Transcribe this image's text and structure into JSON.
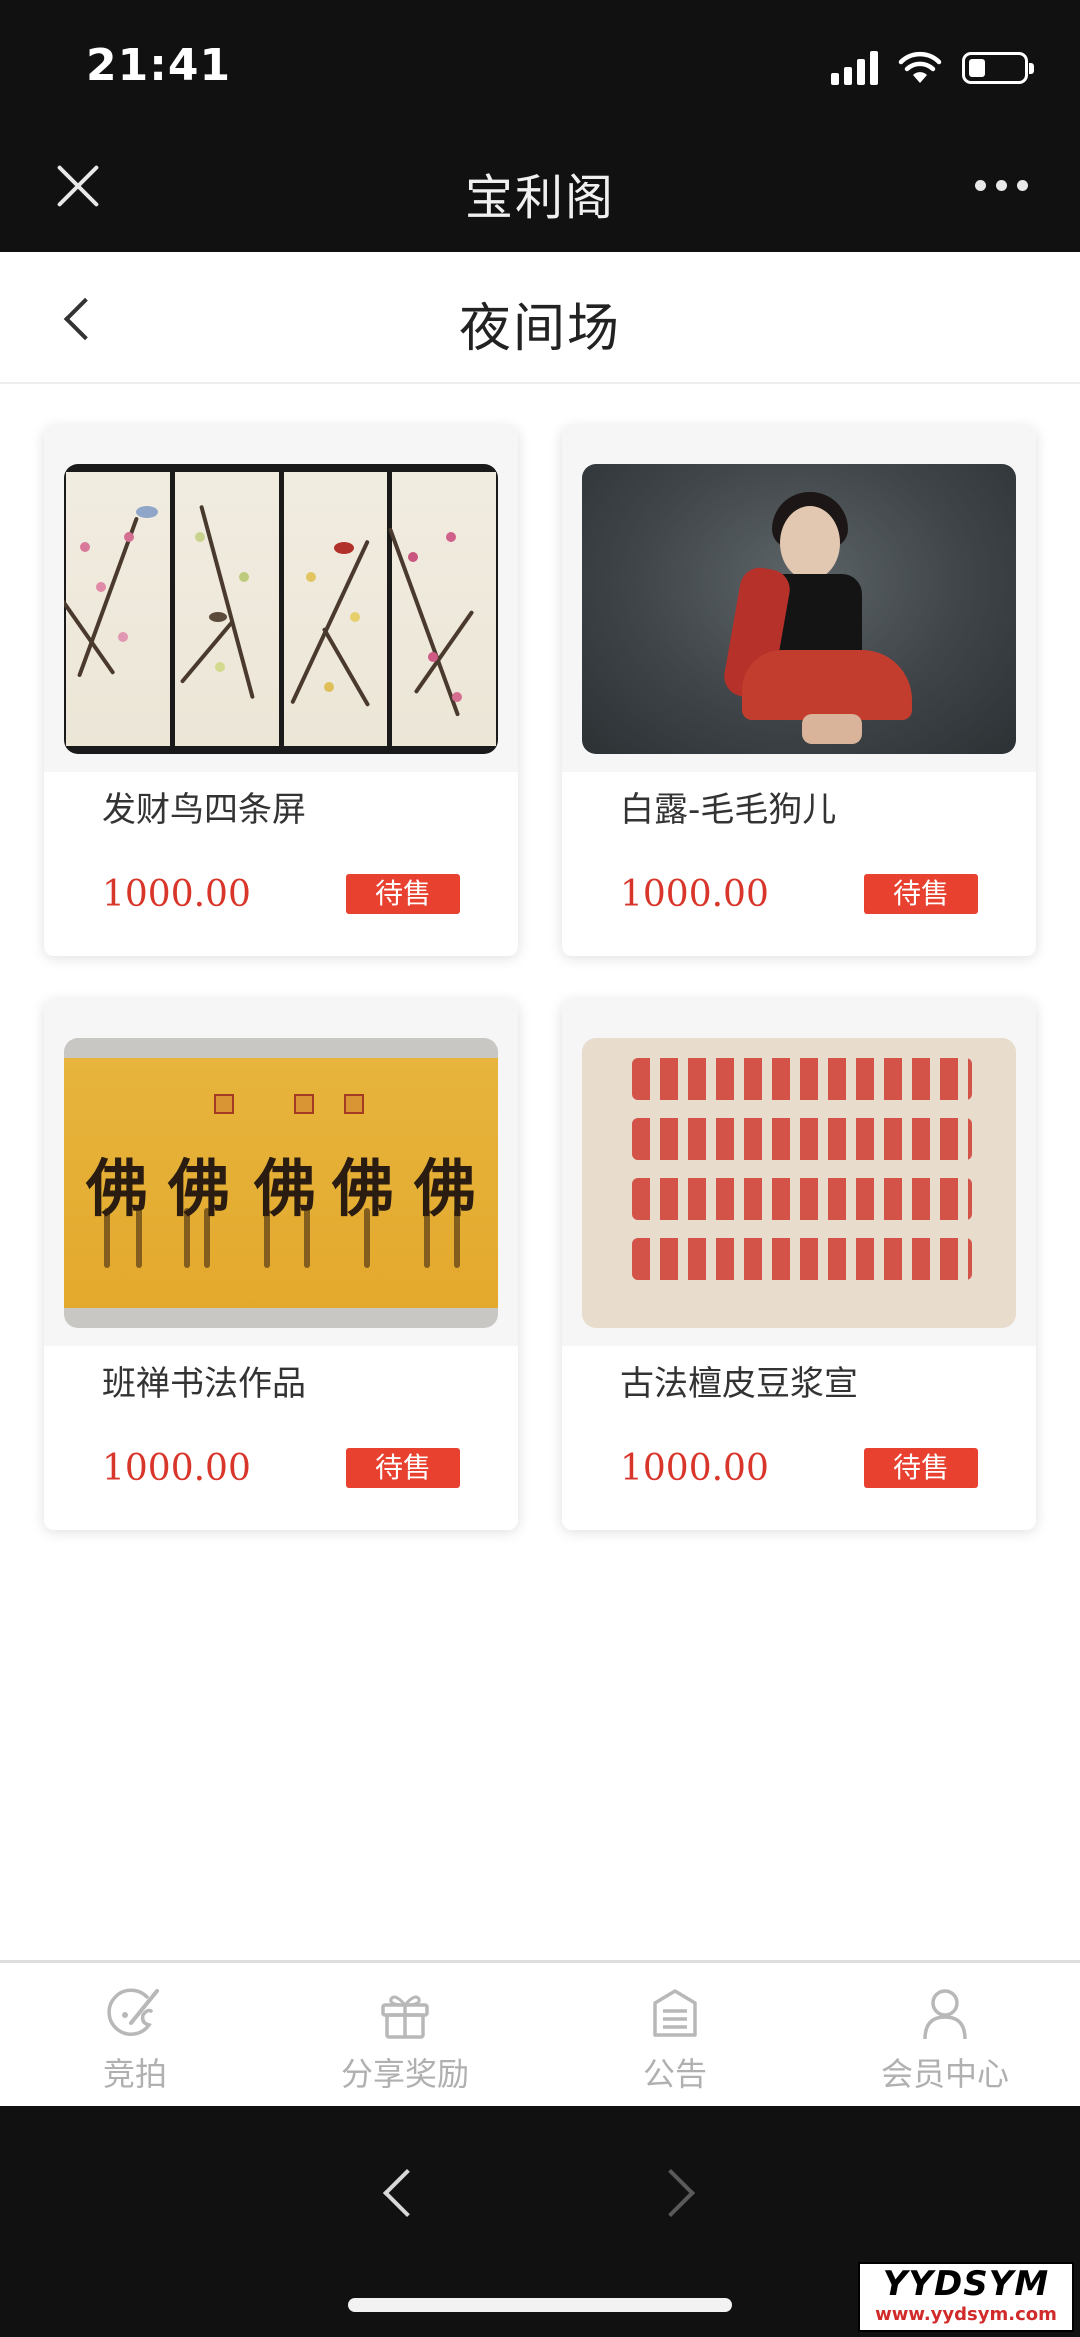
{
  "status_bar": {
    "time": "21:41",
    "battery_level": 0.3
  },
  "header": {
    "app_title": "宝利阁"
  },
  "page": {
    "title": "夜间场"
  },
  "products": [
    {
      "name": "发财鸟四条屏",
      "price": "1000.00",
      "status": "待售"
    },
    {
      "name": "白露-毛毛狗儿",
      "price": "1000.00",
      "status": "待售"
    },
    {
      "name": "班禅书法作品",
      "price": "1000.00",
      "status": "待售"
    },
    {
      "name": "古法檀皮豆浆宣",
      "price": "1000.00",
      "status": "待售"
    }
  ],
  "artwork_text": {
    "calligraphy_glyph": "佛"
  },
  "tabbar": {
    "items": [
      {
        "label": "竞拍",
        "icon": "palette-icon"
      },
      {
        "label": "分享奖励",
        "icon": "gift-icon"
      },
      {
        "label": "公告",
        "icon": "notice-icon"
      },
      {
        "label": "会员中心",
        "icon": "user-icon"
      }
    ]
  },
  "watermark": {
    "main": "YYDSYM",
    "sub": "www.yydsym.com"
  },
  "colors": {
    "price": "#d9362b",
    "badge": "#e8412f",
    "topbar": "#111111",
    "tab_inactive": "#b0b0b0"
  }
}
